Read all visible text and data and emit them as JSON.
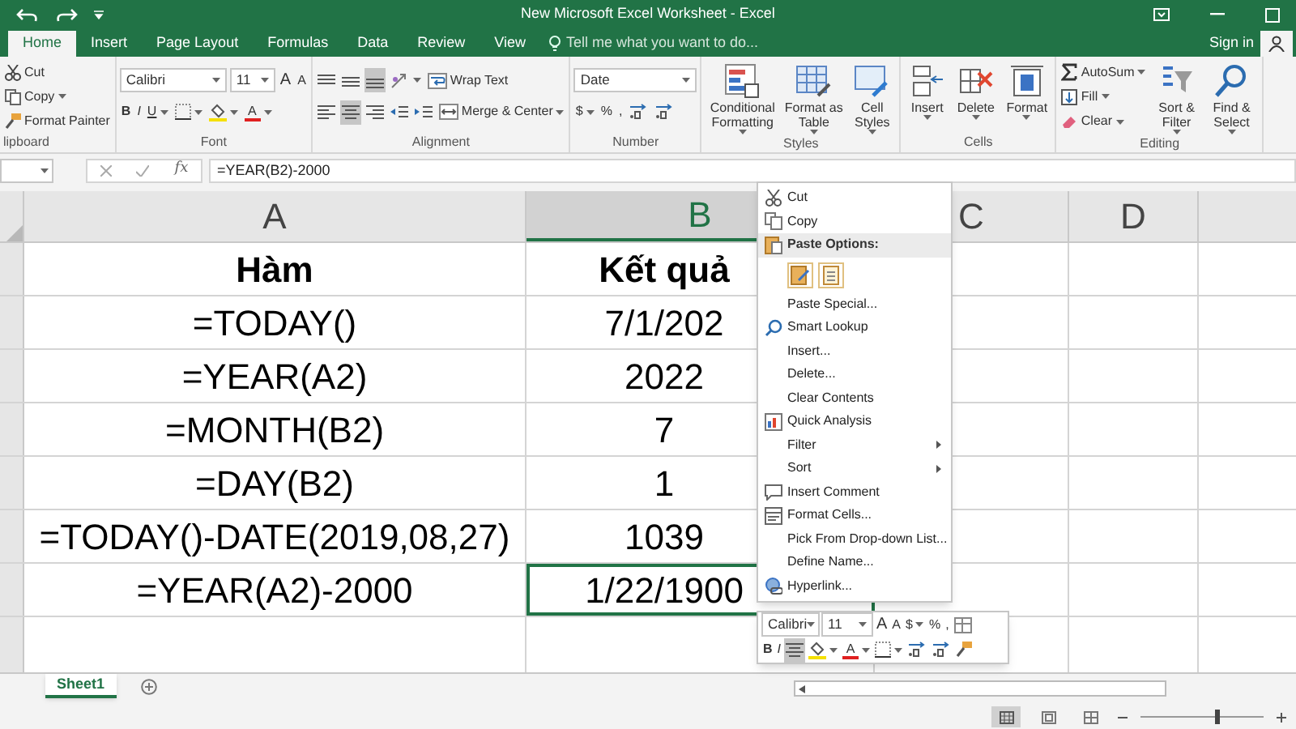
{
  "title_bar": {
    "title": "New Microsoft Excel Worksheet - Excel"
  },
  "tabs": [
    {
      "label": "Home",
      "selected": true
    },
    {
      "label": "Insert",
      "selected": false
    },
    {
      "label": "Page Layout",
      "selected": false
    },
    {
      "label": "Formulas",
      "selected": false
    },
    {
      "label": "Data",
      "selected": false
    },
    {
      "label": "Review",
      "selected": false
    },
    {
      "label": "View",
      "selected": false
    }
  ],
  "tell_me": {
    "placeholder": "Tell me what you want to do..."
  },
  "account": {
    "label": "Sign in"
  },
  "ribbon": {
    "groups": [
      {
        "label": "lipboard",
        "rows": [
          {
            "items": [
              {
                "kind": "button",
                "label": "Cut"
              }
            ]
          },
          {
            "items": [
              {
                "kind": "button",
                "label": "Copy"
              }
            ]
          },
          {
            "items": [
              {
                "kind": "button",
                "label": "Format Painter"
              }
            ]
          }
        ]
      },
      {
        "label": "Font",
        "rows": [
          {
            "items": [
              {
                "kind": "field",
                "value": "Calibri"
              },
              {
                "kind": "field",
                "value": "11"
              },
              {
                "kind": "button",
                "label": "A"
              },
              {
                "kind": "button",
                "label": "A"
              }
            ]
          },
          {
            "items": [
              {
                "kind": "button",
                "label": "B"
              },
              {
                "kind": "button",
                "label": "I"
              },
              {
                "kind": "button",
                "label": "U"
              },
              {
                "kind": "button"
              },
              {
                "kind": "button"
              },
              {
                "kind": "button",
                "label": "A"
              }
            ]
          }
        ]
      },
      {
        "label": "Alignment",
        "rows": [
          {
            "items": [
              {
                "kind": "button",
                "selected": false
              },
              {
                "kind": "button",
                "selected": false
              },
              {
                "kind": "button",
                "selected": true
              },
              {
                "kind": "button",
                "selected": false
              },
              {
                "kind": "button",
                "label": "Wrap Text",
                "selected": false
              }
            ]
          },
          {
            "items": [
              {
                "kind": "button",
                "selected": false
              },
              {
                "kind": "button",
                "selected": true
              },
              {
                "kind": "button",
                "selected": false
              },
              {
                "kind": "button",
                "selected": false
              },
              {
                "kind": "button",
                "selected": false
              },
              {
                "kind": "button",
                "label": "Merge & Center",
                "selected": false
              }
            ]
          }
        ]
      },
      {
        "label": "Number",
        "rows": [
          {
            "items": [
              {
                "kind": "field",
                "value": "Date"
              }
            ]
          },
          {
            "items": [
              {
                "kind": "button",
                "label": "$"
              },
              {
                "kind": "button",
                "label": "%"
              },
              {
                "kind": "button",
                "label": ","
              },
              {
                "kind": "button"
              },
              {
                "kind": "button"
              }
            ]
          }
        ]
      },
      {
        "label": "Styles",
        "buttons": [
          {
            "label": "Conditional Formatting"
          },
          {
            "label": "Format as Table"
          },
          {
            "label": "Cell Styles"
          }
        ]
      },
      {
        "label": "Cells",
        "buttons": [
          {
            "label": "Insert"
          },
          {
            "label": "Delete"
          },
          {
            "label": "Format"
          }
        ]
      },
      {
        "label": "Editing",
        "rows": [
          {
            "items": [
              {
                "kind": "button",
                "label": "AutoSum"
              }
            ]
          },
          {
            "items": [
              {
                "kind": "button",
                "label": "Fill"
              }
            ]
          },
          {
            "items": [
              {
                "kind": "button",
                "label": "Clear"
              }
            ]
          }
        ],
        "buttons": [
          {
            "label": "Sort & Filter"
          },
          {
            "label": "Find & Select"
          }
        ]
      }
    ]
  },
  "formula_bar": {
    "function_label": "fx",
    "formula": "=YEAR(B2)-2000"
  },
  "sheet": {
    "columns": [
      {
        "label": "A",
        "selected": false
      },
      {
        "label": "B",
        "selected": true
      },
      {
        "label": "C",
        "selected": false
      },
      {
        "label": "D",
        "selected": false
      }
    ],
    "rows": [
      {
        "header": true,
        "cells": [
          {
            "text": "Hàm",
            "selected": false
          },
          {
            "text": "Kết quả",
            "selected": false
          }
        ]
      },
      {
        "header": false,
        "cells": [
          {
            "text": "=TODAY()",
            "selected": false
          },
          {
            "text": "7/1/202",
            "selected": false
          }
        ]
      },
      {
        "header": false,
        "cells": [
          {
            "text": "=YEAR(A2)",
            "selected": false
          },
          {
            "text": "2022",
            "selected": false
          }
        ]
      },
      {
        "header": false,
        "cells": [
          {
            "text": "=MONTH(B2)",
            "selected": false
          },
          {
            "text": "7",
            "selected": false
          }
        ]
      },
      {
        "header": false,
        "cells": [
          {
            "text": "=DAY(B2)",
            "selected": false
          },
          {
            "text": "1",
            "selected": false
          }
        ]
      },
      {
        "header": false,
        "cells": [
          {
            "text": "=TODAY()-DATE(2019,08,27)",
            "selected": false
          },
          {
            "text": "1039",
            "selected": false
          }
        ]
      },
      {
        "header": false,
        "cells": [
          {
            "text": "=YEAR(A2)-2000",
            "selected": false
          },
          {
            "text": "1/22/1900",
            "selected": true
          }
        ]
      }
    ]
  },
  "context_menu": {
    "items": [
      {
        "kind": "item",
        "label": "Cut",
        "submenu": false
      },
      {
        "kind": "item",
        "label": "Copy",
        "submenu": false
      },
      {
        "kind": "header",
        "label": "Paste Options:"
      },
      {
        "kind": "paste_icons"
      },
      {
        "kind": "item",
        "label": "Paste Special...",
        "submenu": false
      },
      {
        "kind": "item",
        "label": "Smart Lookup",
        "submenu": false
      },
      {
        "kind": "item",
        "label": "Insert...",
        "submenu": false
      },
      {
        "kind": "item",
        "label": "Delete...",
        "submenu": false
      },
      {
        "kind": "item",
        "label": "Clear Contents",
        "submenu": false
      },
      {
        "kind": "item",
        "label": "Quick Analysis",
        "submenu": false
      },
      {
        "kind": "item",
        "label": "Filter",
        "submenu": true
      },
      {
        "kind": "item",
        "label": "Sort",
        "submenu": true
      },
      {
        "kind": "item",
        "label": "Insert Comment",
        "submenu": false
      },
      {
        "kind": "item",
        "label": "Format Cells...",
        "submenu": false
      },
      {
        "kind": "item",
        "label": "Pick From Drop-down List...",
        "submenu": false
      },
      {
        "kind": "item",
        "label": "Define Name...",
        "submenu": false
      },
      {
        "kind": "item",
        "label": "Hyperlink...",
        "submenu": false
      }
    ]
  },
  "mini_toolbar": {
    "rows": [
      {
        "items": [
          {
            "kind": "field",
            "value": "Calibri"
          },
          {
            "kind": "field",
            "value": "11"
          },
          {
            "kind": "button",
            "label": "A",
            "selected": false
          },
          {
            "kind": "button",
            "label": "A",
            "selected": false
          },
          {
            "kind": "button",
            "label": "$",
            "selected": false
          },
          {
            "kind": "button",
            "label": "%",
            "selected": false
          },
          {
            "kind": "button",
            "label": ",",
            "selected": false
          },
          {
            "kind": "button",
            "selected": false
          }
        ]
      },
      {
        "items": [
          {
            "kind": "button",
            "label": "B",
            "selected": false
          },
          {
            "kind": "button",
            "label": "I",
            "selected": false
          },
          {
            "kind": "button",
            "selected": true
          },
          {
            "kind": "button",
            "selected": false
          },
          {
            "kind": "button",
            "label": "A",
            "selected": false
          },
          {
            "kind": "button",
            "selected": false
          },
          {
            "kind": "button",
            "selected": false
          },
          {
            "kind": "button",
            "selected": false
          },
          {
            "kind": "button",
            "selected": false
          }
        ]
      }
    ]
  },
  "sheet_tabs": [
    {
      "label": "Sheet1",
      "selected": true
    }
  ],
  "status_bar": {
    "view_buttons": [
      {
        "selected": true
      },
      {
        "selected": false
      },
      {
        "selected": false
      }
    ],
    "zoom_slider": {
      "level": 0.62
    }
  }
}
